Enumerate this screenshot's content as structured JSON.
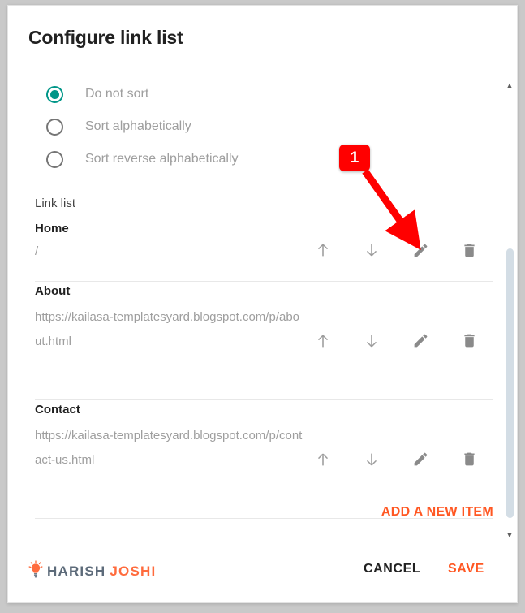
{
  "dialog": {
    "title": "Configure link list"
  },
  "sort_options": {
    "items": [
      {
        "label": "Do not sort",
        "selected": true
      },
      {
        "label": "Sort alphabetically",
        "selected": false
      },
      {
        "label": "Sort reverse alphabetically",
        "selected": false
      }
    ]
  },
  "link_list": {
    "heading": "Link list",
    "items": [
      {
        "title": "Home",
        "url": "/"
      },
      {
        "title": "About",
        "url": "https://kailasa-templatesyard.blogspot.com/p/about.html"
      },
      {
        "title": "Contact",
        "url": "https://kailasa-templatesyard.blogspot.com/p/contact-us.html"
      }
    ],
    "actions": {
      "move_up": "move-up-icon",
      "move_down": "move-down-icon",
      "edit": "edit-pencil-icon",
      "delete": "delete-trash-icon"
    },
    "add_label": "ADD A NEW ITEM"
  },
  "footer": {
    "brand_first": "HARISH",
    "brand_second": "JOSHI",
    "cancel_label": "CANCEL",
    "save_label": "SAVE"
  },
  "annotation": {
    "step_number": "1"
  },
  "scrollbar": {
    "up_glyph": "▲",
    "down_glyph": "▼"
  },
  "colors": {
    "radio_selected": "#009688",
    "accent_orange": "#ff5722",
    "annotation_red": "#ff0000",
    "brand_gray": "#5d6b7a",
    "icon_gray": "#8a8a8a"
  }
}
